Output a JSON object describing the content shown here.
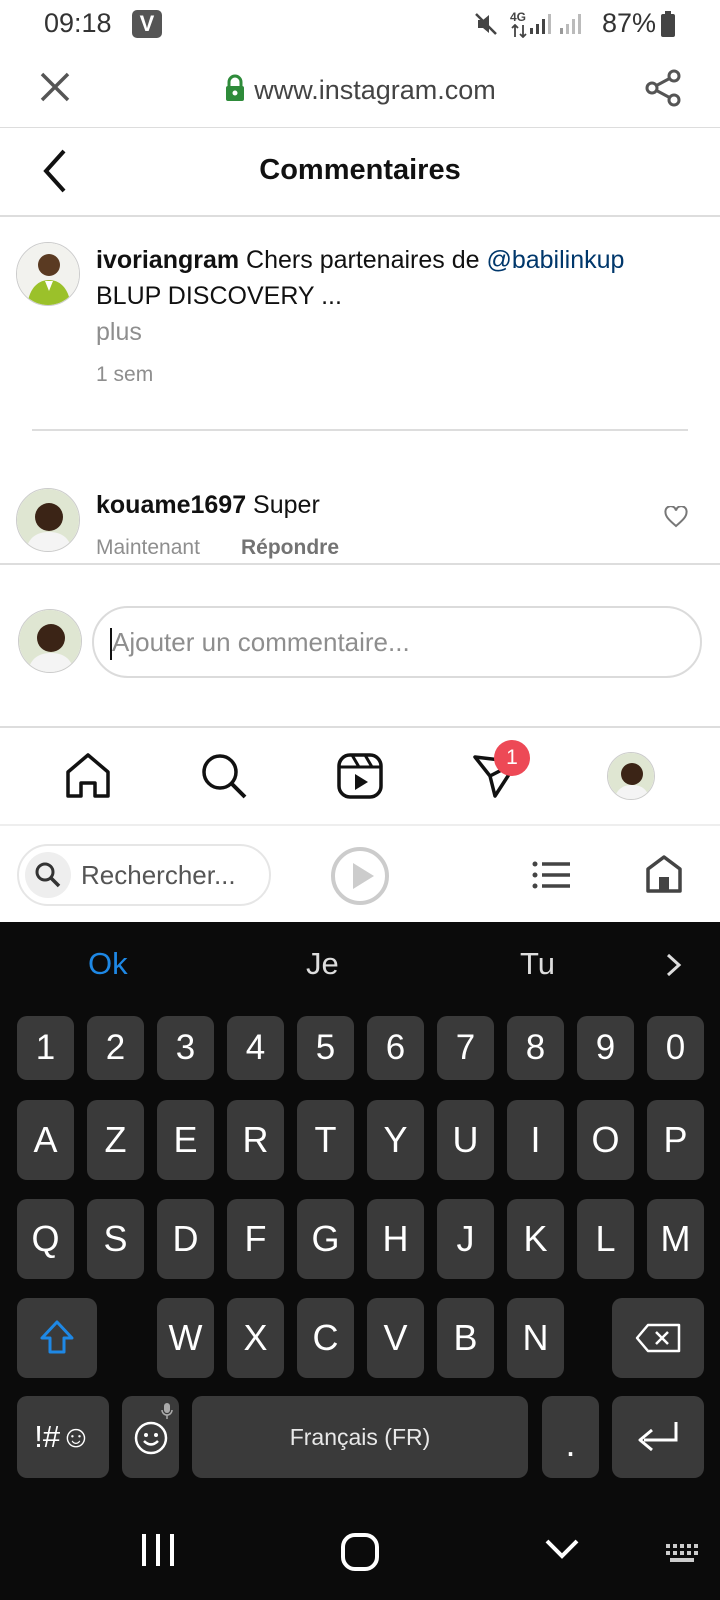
{
  "status_bar": {
    "time": "09:18",
    "battery": "87%",
    "network": "4G"
  },
  "browser": {
    "url": "www.instagram.com"
  },
  "header": {
    "title": "Commentaires"
  },
  "caption": {
    "username": "ivoriangram",
    "text": " Chers partenaires de ",
    "mention": "@babilinkup",
    "line2": "BLUP DISCOVERY ...",
    "more": "plus",
    "time": "1 sem"
  },
  "comment": {
    "username": "kouame1697",
    "text": " Super",
    "time": "Maintenant",
    "reply": "Répondre"
  },
  "composer": {
    "placeholder": "Ajouter un commentaire..."
  },
  "bottom_nav": {
    "badge": "1"
  },
  "browser_toolbar": {
    "search_placeholder": "Rechercher..."
  },
  "keyboard": {
    "suggestions": [
      "Ok",
      "Je",
      "Tu"
    ],
    "row_numbers": [
      "1",
      "2",
      "3",
      "4",
      "5",
      "6",
      "7",
      "8",
      "9",
      "0"
    ],
    "row1": [
      "A",
      "Z",
      "E",
      "R",
      "T",
      "Y",
      "U",
      "I",
      "O",
      "P"
    ],
    "row2": [
      "Q",
      "S",
      "D",
      "F",
      "G",
      "H",
      "J",
      "K",
      "L",
      "M"
    ],
    "row3": [
      "W",
      "X",
      "C",
      "V",
      "B",
      "N"
    ],
    "symbols": "!#☺",
    "space": "Français (FR)",
    "period": "."
  },
  "colors": {
    "accent": "#1e88e5",
    "badge": "#ed4956",
    "keyboard_bg": "#0b0b0b",
    "key_bg": "#3a3a3a"
  }
}
